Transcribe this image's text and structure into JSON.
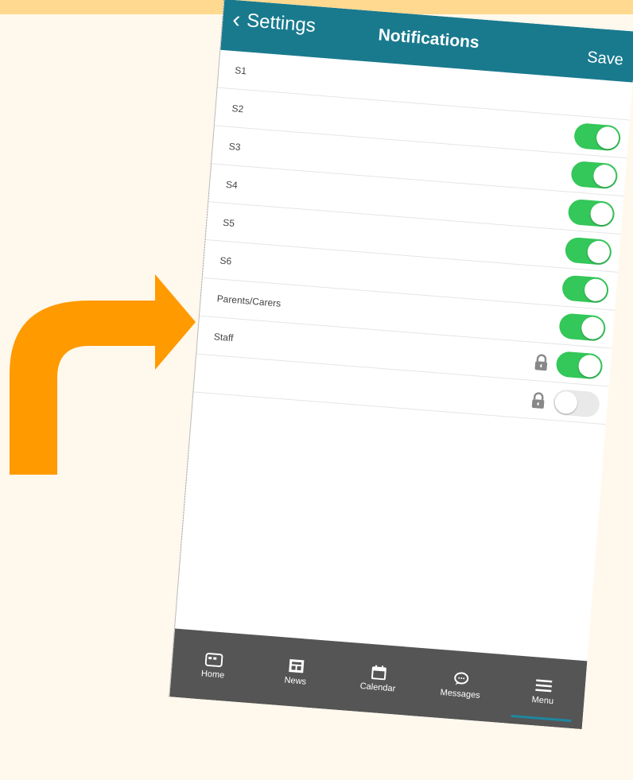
{
  "header": {
    "back_label": "Settings",
    "title": "Notifications",
    "save_label": "Save"
  },
  "rows": [
    {
      "label": "S1",
      "toggle": null,
      "locked": false
    },
    {
      "label": "S2",
      "toggle": true,
      "locked": false
    },
    {
      "label": "S3",
      "toggle": true,
      "locked": false
    },
    {
      "label": "S4",
      "toggle": true,
      "locked": false
    },
    {
      "label": "S5",
      "toggle": true,
      "locked": false
    },
    {
      "label": "S6",
      "toggle": true,
      "locked": false
    },
    {
      "label": "Parents/Carers",
      "toggle": true,
      "locked": false
    },
    {
      "label": "Staff",
      "toggle": true,
      "locked": true
    },
    {
      "label": "",
      "toggle": false,
      "locked": true
    }
  ],
  "tabs": [
    {
      "label": "Home",
      "icon": "home-icon"
    },
    {
      "label": "News",
      "icon": "news-icon"
    },
    {
      "label": "Calendar",
      "icon": "calendar-icon"
    },
    {
      "label": "Messages",
      "icon": "messages-icon"
    },
    {
      "label": "Menu",
      "icon": "menu-icon",
      "active": true
    }
  ],
  "colors": {
    "header": "#197A8E",
    "toggle_on": "#34C759",
    "toggle_off": "#E9E9EA",
    "tabbar": "#555555",
    "arrow": "#FF9A00",
    "background": "#FFF8EC",
    "top_strip": "#FFD990"
  }
}
